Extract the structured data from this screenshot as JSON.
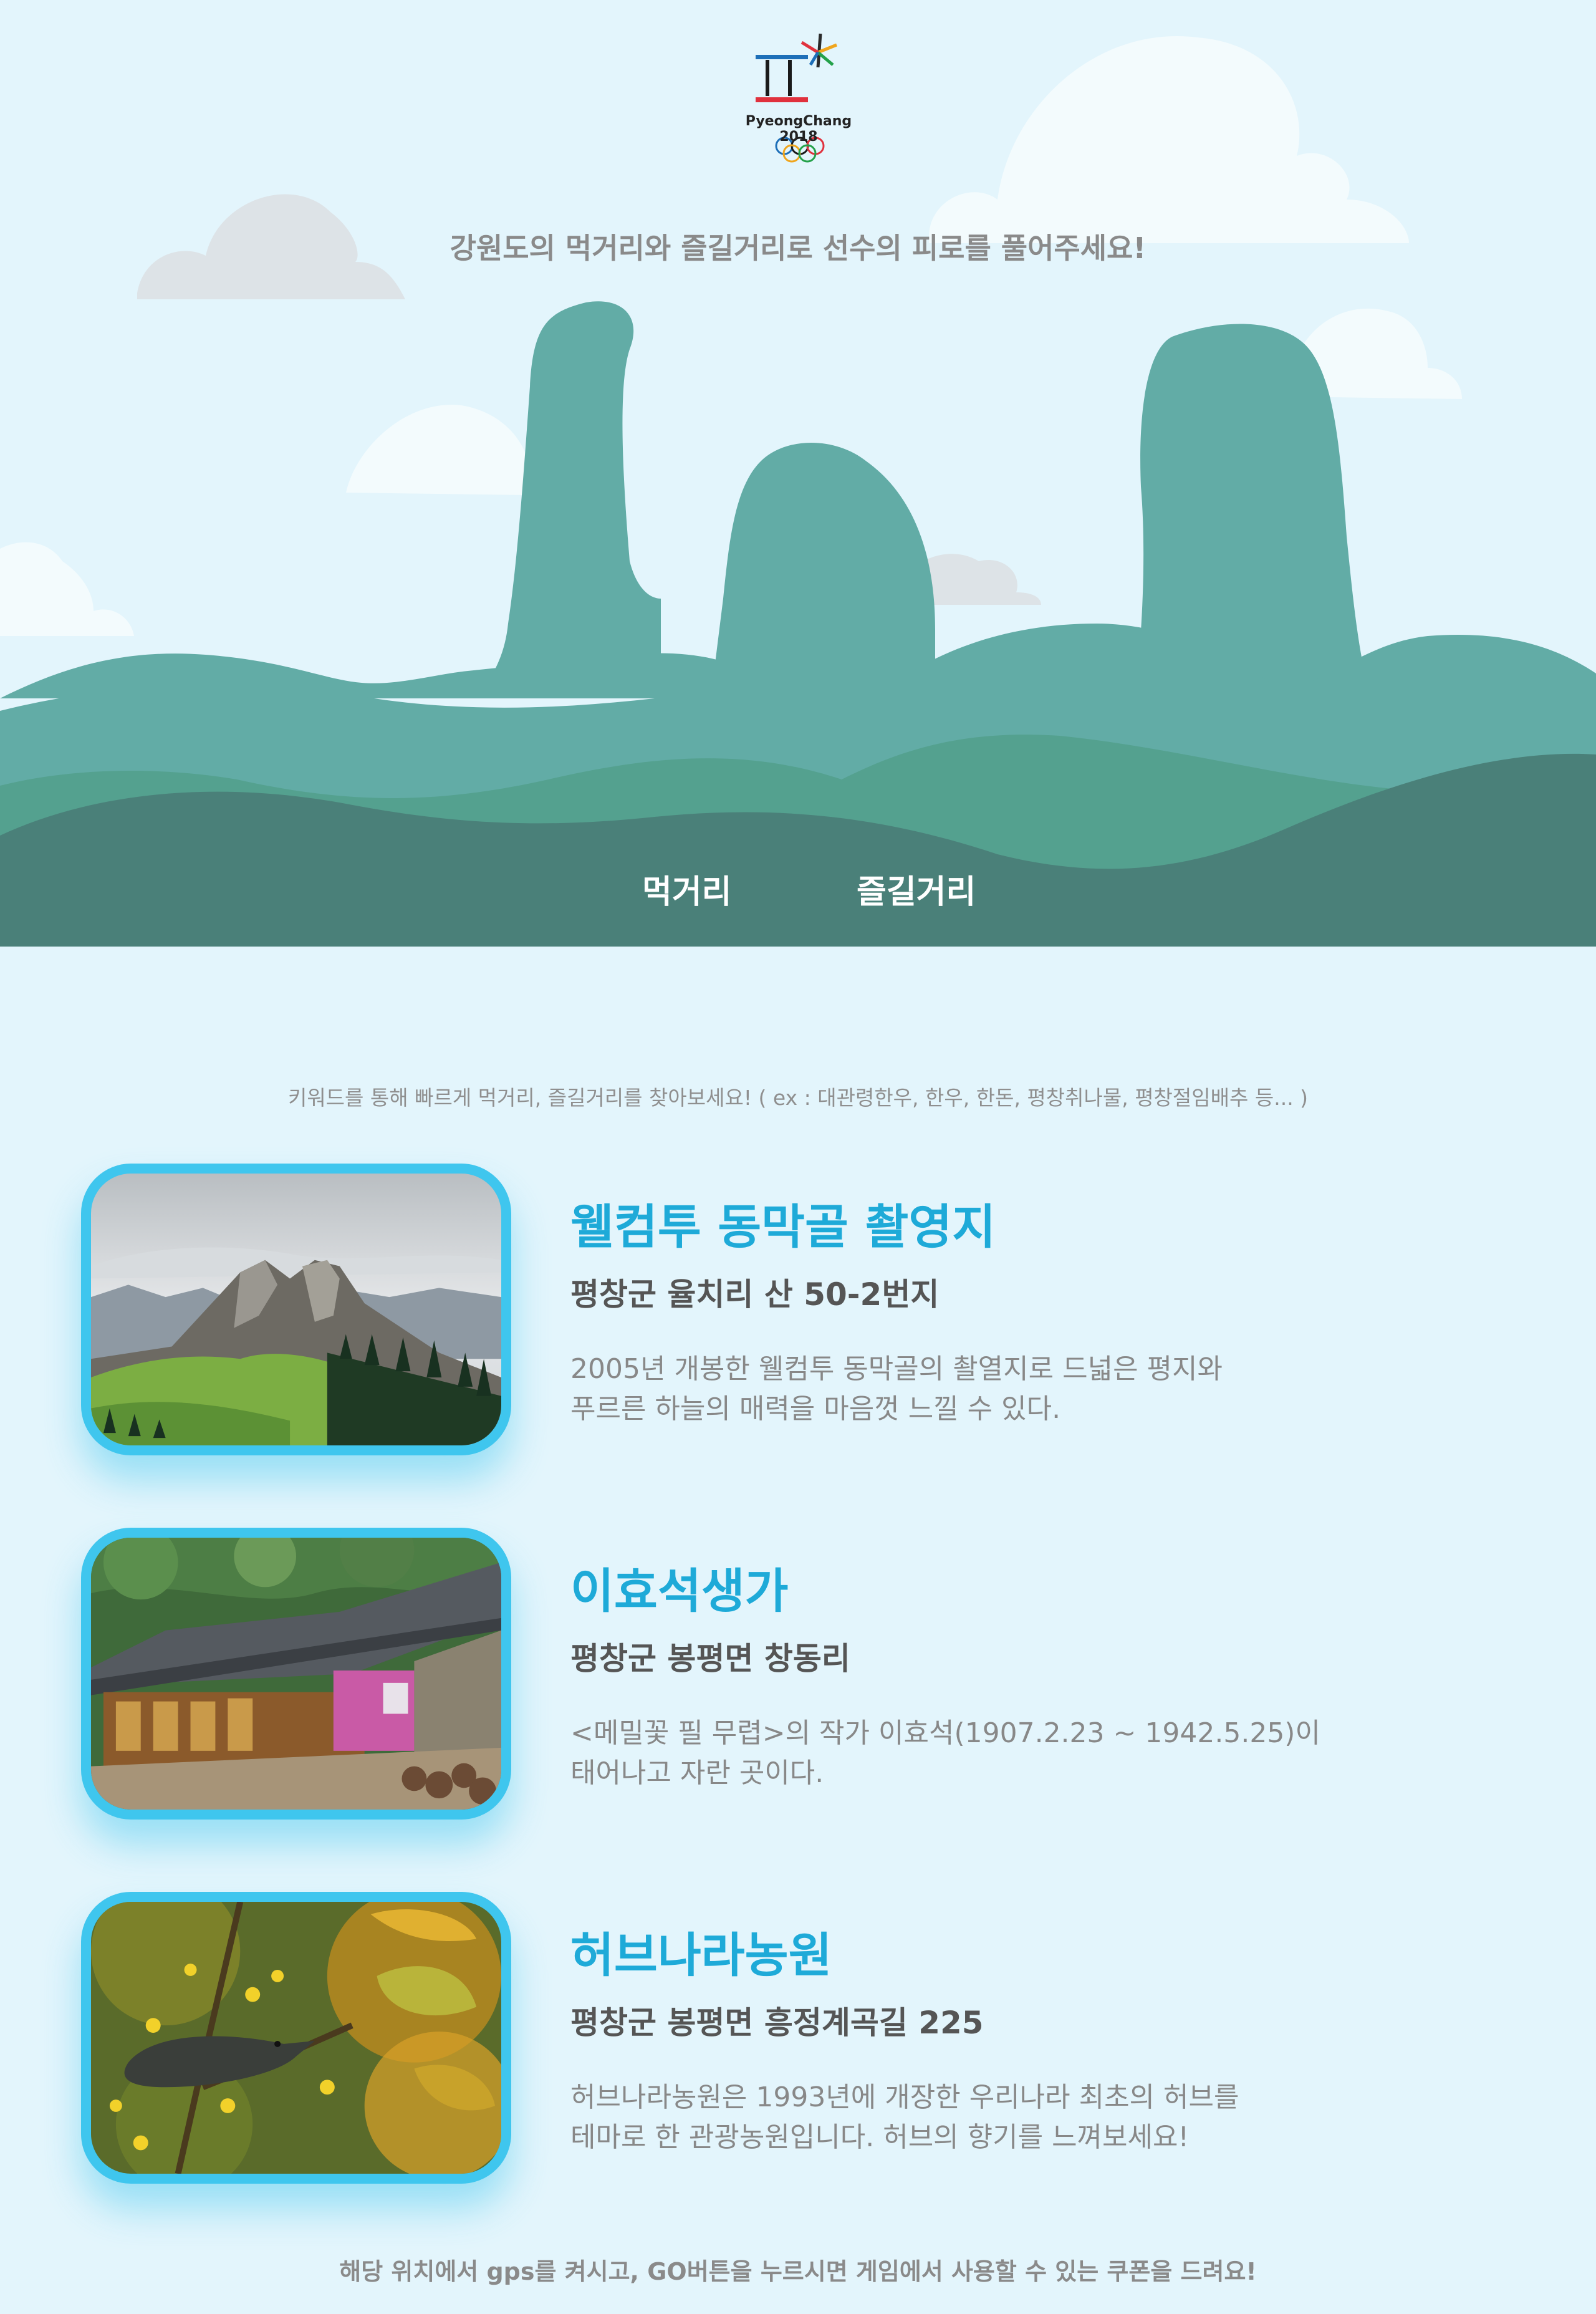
{
  "header": {
    "logo_text": "PyeongChang 2018",
    "tagline": "강원도의 먹거리와 즐길거리로 선수의 피로를 풀어주세요!"
  },
  "nav": {
    "items": [
      {
        "label": "먹거리"
      },
      {
        "label": "즐길거리"
      }
    ]
  },
  "hint": "키워드를 통해 빠르게 먹거리, 즐길거리를 찾아보세요! ( ex : 대관령한우, 한우, 한돈, 평창취나물, 평창절임배추 등... )",
  "places": [
    {
      "title": "웰컴투 동막골 촬영지",
      "address": "평창군 율치리 산 50-2번지",
      "desc_line1": "2005년 개봉한 웰컴투 동막골의 촬열지로 드넓은 평지와",
      "desc_line2": "푸르른 하늘의 매력을 마음껏 느낄 수 있다.",
      "image": "mountain-photo"
    },
    {
      "title": "이효석생가",
      "address": "평창군 봉평면 창동리",
      "desc_line1": "<메밀꽃 필 무렵>의 작가 이효석(1907.2.23 ~ 1942.5.25)이",
      "desc_line2": "태어나고 자란 곳이다.",
      "image": "traditional-house-photo"
    },
    {
      "title": "허브나라농원",
      "address": "평창군 봉평면 흥정계곡길 225",
      "desc_line1": "허브나라농원은 1993년에 개장한 우리나라 최초의 허브를",
      "desc_line2": "테마로 한 관광농원입니다. 허브의 향기를 느껴보세요!",
      "image": "bird-flowers-photo"
    }
  ],
  "footer": "해당 위치에서 gps를 켜시고, GO버튼을 누르시면 게임에서 사용할 수 있는 쿠폰을 드려요!",
  "colors": {
    "background": "#e3f5fc",
    "accent": "#3fc6ee",
    "title": "#1eaad8",
    "hill_light": "#62aca6",
    "hill_mid": "#4f9f8c",
    "hill_dark": "#4a8079"
  }
}
